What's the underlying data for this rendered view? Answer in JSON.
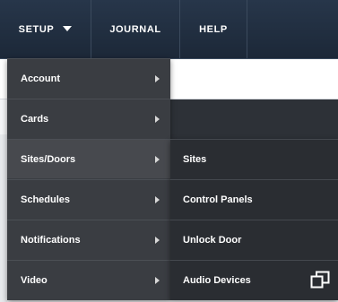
{
  "nav": {
    "setup": "SETUP",
    "journal": "JOURNAL",
    "help": "HELP"
  },
  "setup_menu": {
    "items": [
      {
        "label": "Account"
      },
      {
        "label": "Cards"
      },
      {
        "label": "Sites/Doors"
      },
      {
        "label": "Schedules"
      },
      {
        "label": "Notifications"
      },
      {
        "label": "Video"
      }
    ],
    "active_item": "Sites/Doors"
  },
  "sites_doors_submenu": {
    "items": [
      {
        "label": "Sites"
      },
      {
        "label": "Control Panels"
      },
      {
        "label": "Unlock Door"
      },
      {
        "label": "Audio Devices"
      }
    ]
  },
  "icons": {
    "nav_caret": "chevron-down-icon",
    "submenu_arrow": "chevron-right-icon",
    "popout": "popout-window-icon"
  },
  "colors": {
    "topbar": "#27364a",
    "menu_bg": "#3a3d42",
    "submenu_bg": "#2a2d32",
    "text": "#ffffff"
  }
}
